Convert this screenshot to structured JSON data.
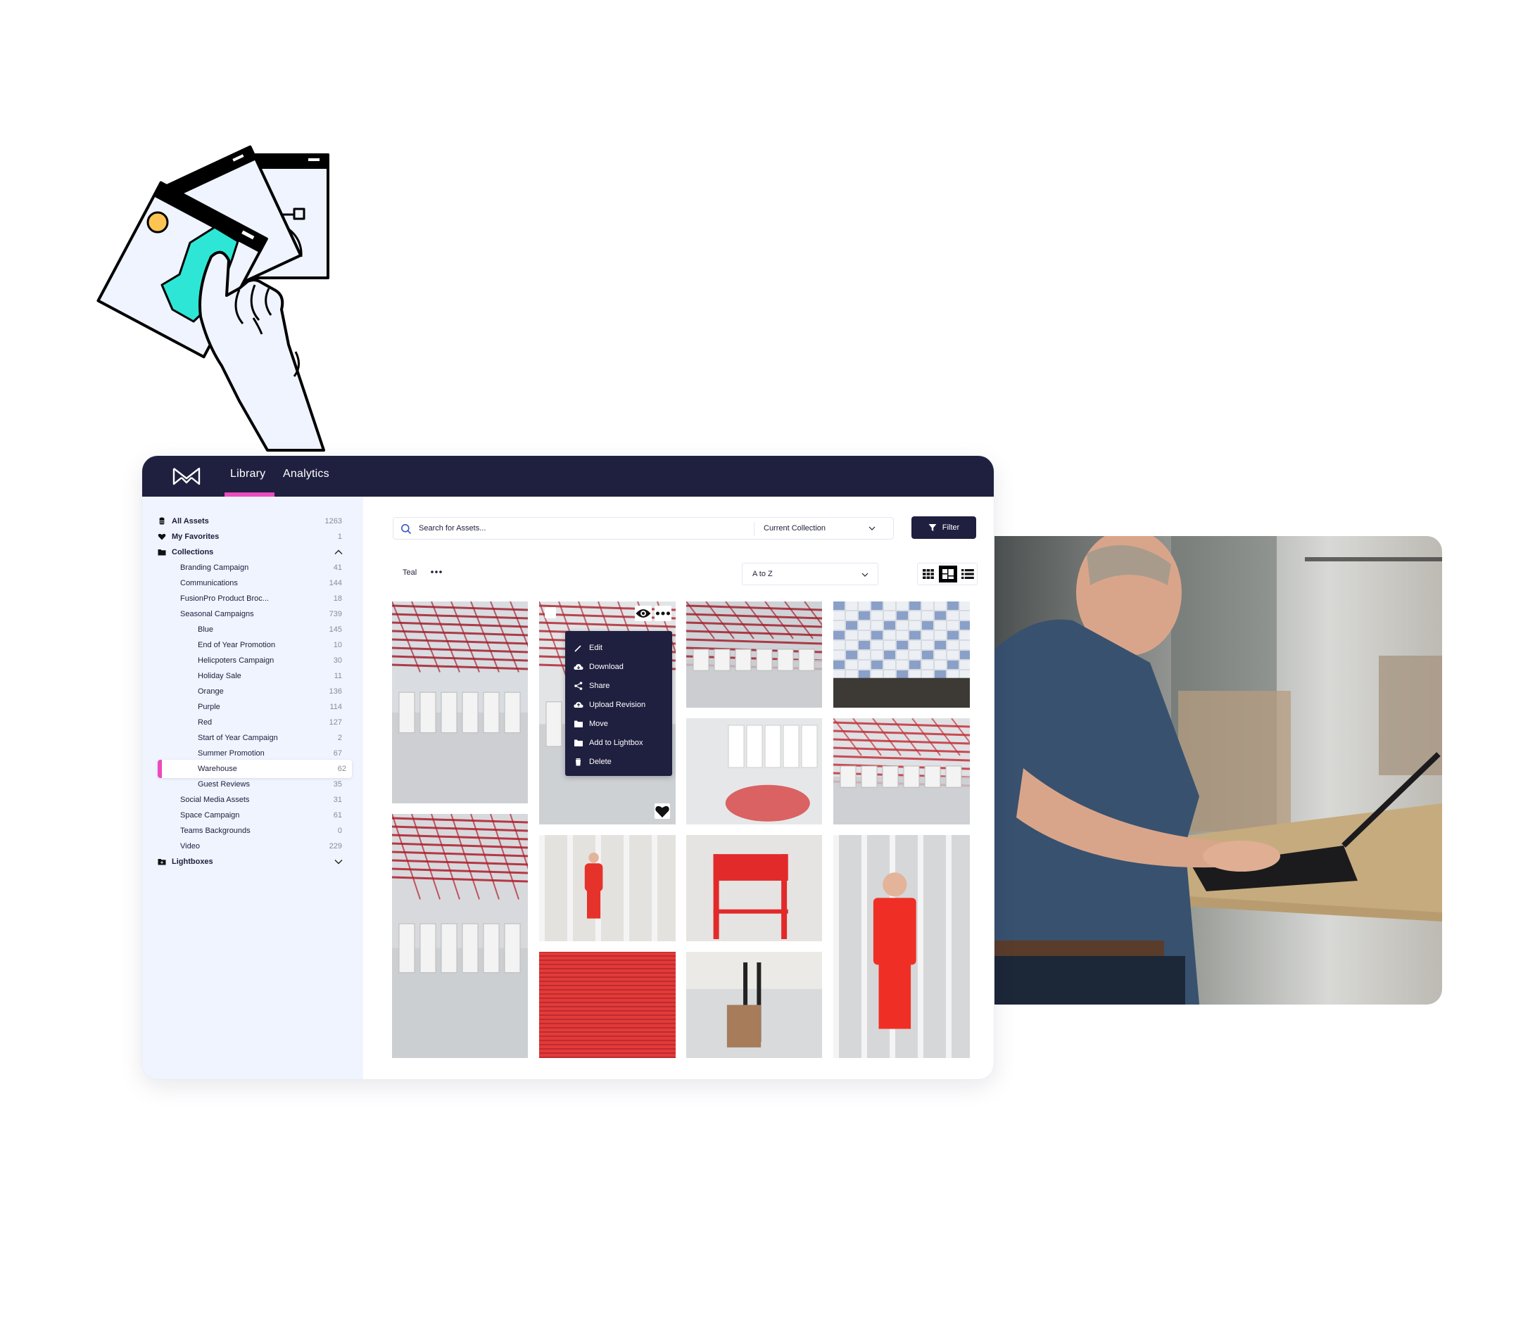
{
  "header": {
    "logo": "brand-logo",
    "tabs": [
      {
        "label": "Library",
        "active": true
      },
      {
        "label": "Analytics",
        "active": false
      }
    ],
    "accent_color": "#ec4bbd",
    "nav_color": "#1f1f3f"
  },
  "sidebar": {
    "all_assets": {
      "label": "All Assets",
      "count": "1263",
      "icon": "database-icon"
    },
    "favorites": {
      "label": "My Favorites",
      "count": "1",
      "icon": "heart-icon"
    },
    "collections": {
      "label": "Collections",
      "icon": "folder-icon",
      "expanded": true
    },
    "collection_items": [
      {
        "label": "Branding Campaign",
        "count": "41",
        "level": 1
      },
      {
        "label": "Communications",
        "count": "144",
        "level": 1
      },
      {
        "label": "FusionPro Product Broc...",
        "count": "18",
        "level": 1
      },
      {
        "label": "Seasonal Campaigns",
        "count": "739",
        "level": 1
      },
      {
        "label": "Blue",
        "count": "145",
        "level": 2
      },
      {
        "label": "End of Year Promotion",
        "count": "10",
        "level": 2
      },
      {
        "label": "Helicpoters Campaign",
        "count": "30",
        "level": 2
      },
      {
        "label": "Holiday Sale",
        "count": "11",
        "level": 2
      },
      {
        "label": "Orange",
        "count": "136",
        "level": 2
      },
      {
        "label": "Purple",
        "count": "114",
        "level": 2
      },
      {
        "label": "Red",
        "count": "127",
        "level": 2
      },
      {
        "label": "Start of Year Campaign",
        "count": "2",
        "level": 2
      },
      {
        "label": "Summer Promotion",
        "count": "67",
        "level": 2
      },
      {
        "label": "Warehouse",
        "count": "62",
        "level": 2,
        "active": true
      },
      {
        "label": "Guest Reviews",
        "count": "35",
        "level": 2
      },
      {
        "label": "Social Media Assets",
        "count": "31",
        "level": 1
      },
      {
        "label": "Space Campaign",
        "count": "61",
        "level": 1
      },
      {
        "label": "Teams Backgrounds",
        "count": "0",
        "level": 1
      },
      {
        "label": "Video",
        "count": "229",
        "level": 1
      }
    ],
    "lightboxes": {
      "label": "Lightboxes",
      "icon": "folder-plus-icon",
      "expanded": false
    }
  },
  "toolbar": {
    "search_placeholder": "Search for Assets...",
    "scope": "Current Collection",
    "filter_label": "Filter",
    "breadcrumb": "Teal",
    "sort": "A to Z",
    "views": [
      "small-grid",
      "masonry",
      "list"
    ],
    "active_view": "masonry"
  },
  "context_menu": {
    "items": [
      {
        "label": "Edit",
        "icon": "pencil-icon"
      },
      {
        "label": "Download",
        "icon": "cloud-download-icon"
      },
      {
        "label": "Share",
        "icon": "share-icon"
      },
      {
        "label": "Upload Revision",
        "icon": "cloud-upload-icon"
      },
      {
        "label": "Move",
        "icon": "folder-icon"
      },
      {
        "label": "Add to Lightbox",
        "icon": "folder-icon"
      },
      {
        "label": "Delete",
        "icon": "trash-icon"
      }
    ]
  },
  "grid": {
    "tiles": [
      {
        "subject": "warehouse-interior-red-beams"
      },
      {
        "subject": "warehouse-shelves",
        "hovered": true
      },
      {
        "subject": "warehouse-ceiling-ducts"
      },
      {
        "subject": "restaurant-tile-wall"
      },
      {
        "subject": "warehouse-mezzanine-boxes"
      },
      {
        "subject": "warehouse-skylight"
      },
      {
        "subject": "warehouse-hall-scissor-lift"
      },
      {
        "subject": "worker-in-red-suit-shelves"
      },
      {
        "subject": "red-metal-cart"
      },
      {
        "subject": "worker-with-pallet-jack"
      },
      {
        "subject": "red-shutter-texture"
      },
      {
        "subject": "forklift-with-boxes"
      }
    ]
  },
  "photo": {
    "subject": "man-typing-on-laptop-in-warehouse"
  }
}
